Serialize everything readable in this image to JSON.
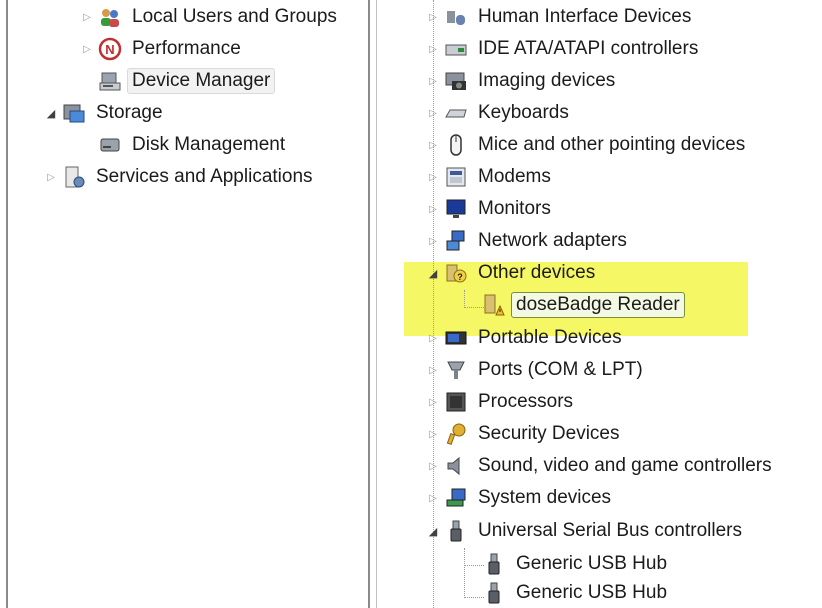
{
  "left_tree": {
    "items": [
      {
        "label": "Local Users and Groups",
        "icon": "users-group-icon",
        "state": "collapsed"
      },
      {
        "label": "Performance",
        "icon": "performance-icon",
        "state": "collapsed"
      },
      {
        "label": "Device Manager",
        "icon": "device-manager-icon",
        "state": "leaf",
        "selected": true
      },
      {
        "label": "Storage",
        "icon": "storage-icon",
        "state": "expanded"
      },
      {
        "label": "Disk Management",
        "icon": "disk-management-icon",
        "state": "leaf"
      },
      {
        "label": "Services and Applications",
        "icon": "services-icon",
        "state": "collapsed"
      }
    ]
  },
  "device_tree": {
    "items": [
      {
        "label": "Human Interface Devices",
        "icon": "hid-icon",
        "state": "collapsed"
      },
      {
        "label": "IDE ATA/ATAPI controllers",
        "icon": "ide-controller-icon",
        "state": "collapsed"
      },
      {
        "label": "Imaging devices",
        "icon": "camera-icon",
        "state": "collapsed"
      },
      {
        "label": "Keyboards",
        "icon": "keyboard-icon",
        "state": "collapsed"
      },
      {
        "label": "Mice and other pointing devices",
        "icon": "mouse-icon",
        "state": "collapsed"
      },
      {
        "label": "Modems",
        "icon": "modem-icon",
        "state": "collapsed"
      },
      {
        "label": "Monitors",
        "icon": "monitor-icon",
        "state": "collapsed"
      },
      {
        "label": "Network adapters",
        "icon": "network-adapter-icon",
        "state": "collapsed"
      },
      {
        "label": "Other devices",
        "icon": "unknown-device-icon",
        "state": "expanded",
        "highlighted": true
      },
      {
        "label": "doseBadge Reader",
        "icon": "warning-device-icon",
        "state": "leaf",
        "selected": true,
        "highlighted": true
      },
      {
        "label": "Portable Devices",
        "icon": "portable-device-icon",
        "state": "collapsed"
      },
      {
        "label": "Ports (COM & LPT)",
        "icon": "port-icon",
        "state": "collapsed"
      },
      {
        "label": "Processors",
        "icon": "processor-icon",
        "state": "collapsed"
      },
      {
        "label": "Security Devices",
        "icon": "security-key-icon",
        "state": "collapsed"
      },
      {
        "label": "Sound, video and game controllers",
        "icon": "speaker-icon",
        "state": "collapsed"
      },
      {
        "label": "System devices",
        "icon": "system-device-icon",
        "state": "collapsed"
      },
      {
        "label": "Universal Serial Bus controllers",
        "icon": "usb-icon",
        "state": "expanded"
      },
      {
        "label": "Generic USB Hub",
        "icon": "usb-icon",
        "state": "leaf"
      },
      {
        "label": "Generic USB Hub",
        "icon": "usb-icon",
        "state": "leaf"
      }
    ]
  },
  "colors": {
    "highlight": "#f4f64a",
    "selection_border": "#7a8f3a",
    "text": "#1b1b1b"
  }
}
